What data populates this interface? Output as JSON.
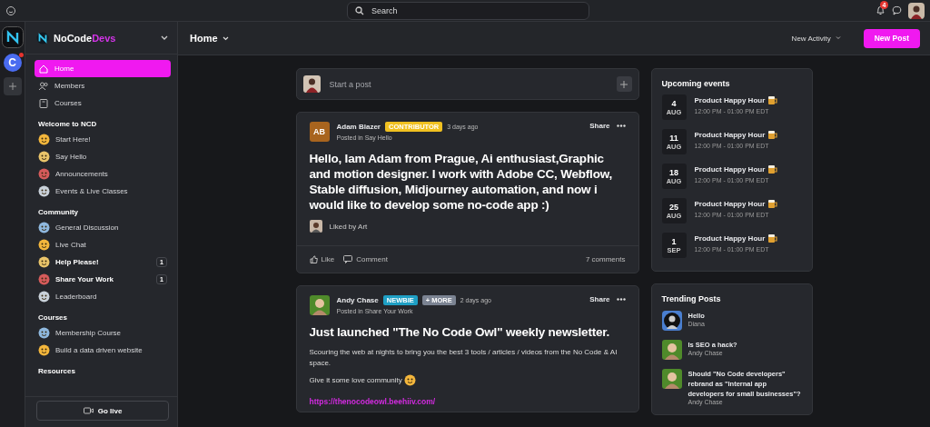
{
  "topbar": {
    "search": {
      "placeholder": "Search"
    },
    "notifications": {
      "count": "4"
    }
  },
  "rail": {
    "letter_avatar": "C",
    "letter_unread": true
  },
  "sidebar": {
    "brand": {
      "name": "NoCode",
      "accent": "Devs"
    },
    "nav": [
      {
        "label": "Home",
        "selected": true
      },
      {
        "label": "Members",
        "selected": false
      },
      {
        "label": "Courses",
        "selected": false
      }
    ],
    "sections": [
      {
        "title": "Welcome to NCD",
        "items": [
          {
            "label": "Start Here!",
            "unread": false
          },
          {
            "label": "Say Hello",
            "unread": false
          },
          {
            "label": "Announcements",
            "unread": false
          },
          {
            "label": "Events & Live Classes",
            "unread": false
          }
        ]
      },
      {
        "title": "Community",
        "items": [
          {
            "label": "General Discussion",
            "unread": false
          },
          {
            "label": "Live Chat",
            "unread": false
          },
          {
            "label": "Help Please!",
            "unread": true,
            "count": "1"
          },
          {
            "label": "Share Your Work",
            "unread": true,
            "count": "1"
          },
          {
            "label": "Leaderboard",
            "unread": false
          }
        ]
      },
      {
        "title": "Courses",
        "items": [
          {
            "label": "Membership Course",
            "unread": false
          },
          {
            "label": "Build a data driven website",
            "unread": false
          }
        ]
      },
      {
        "title": "Resources"
      }
    ],
    "footer_button": "Go live"
  },
  "header": {
    "title": "Home",
    "sort": "New Activity",
    "new_post": "New Post"
  },
  "composer": {
    "placeholder": "Start a post"
  },
  "posts": [
    {
      "author": "Adam Blazer",
      "initials": "AB",
      "badges": [
        {
          "label": "CONTRIBUTOR",
          "color": "#f0c020"
        }
      ],
      "time": "3 days ago",
      "posted_in": "Posted in Say Hello",
      "share": "Share",
      "title": "Hello, Iam Adam from Prague, Ai enthusiast,Graphic and motion designer. I work with Adobe CC, Webflow, Stable diffusion, Midjourney automation, and now i would like to develop some no-code app :)",
      "liked_by": "Liked by Art",
      "like": "Like",
      "comment": "Comment",
      "comments": "7 comments"
    },
    {
      "author": "Andy Chase",
      "badges": [
        {
          "label": "NEWBIE",
          "color": "#1e9fc4"
        },
        {
          "label": "+ MORE",
          "color": "#7b8392"
        }
      ],
      "time": "2 days ago",
      "posted_in": "Posted in Share Your Work",
      "share": "Share",
      "title": "Just launched \"The No Code Owl\" weekly newsletter.",
      "paragraphs": [
        "Scouring the web at nights to bring you the best 3 tools / articles / videos from the No Code & AI space.",
        "Give it some love community"
      ],
      "link": "https://thenocodeowl.beehiiv.com/"
    }
  ],
  "events": {
    "title": "Upcoming events",
    "items": [
      {
        "day": "4",
        "month": "AUG",
        "name": "Product Happy Hour",
        "time": "12:00 PM - 01:00 PM EDT"
      },
      {
        "day": "11",
        "month": "AUG",
        "name": "Product Happy Hour",
        "time": "12:00 PM - 01:00 PM EDT"
      },
      {
        "day": "18",
        "month": "AUG",
        "name": "Product Happy Hour",
        "time": "12:00 PM - 01:00 PM EDT"
      },
      {
        "day": "25",
        "month": "AUG",
        "name": "Product Happy Hour",
        "time": "12:00 PM - 01:00 PM EDT"
      },
      {
        "day": "1",
        "month": "SEP",
        "name": "Product Happy Hour",
        "time": "12:00 PM - 01:00 PM EDT"
      }
    ]
  },
  "trending": {
    "title": "Trending Posts",
    "items": [
      {
        "title": "Hello",
        "author": "Diana"
      },
      {
        "title": "Is SEO a hack?",
        "author": "Andy Chase"
      },
      {
        "title": "Should \"No Code developers\" rebrand as \"Internal app developers for small businesses\"?",
        "author": "Andy Chase"
      }
    ]
  }
}
